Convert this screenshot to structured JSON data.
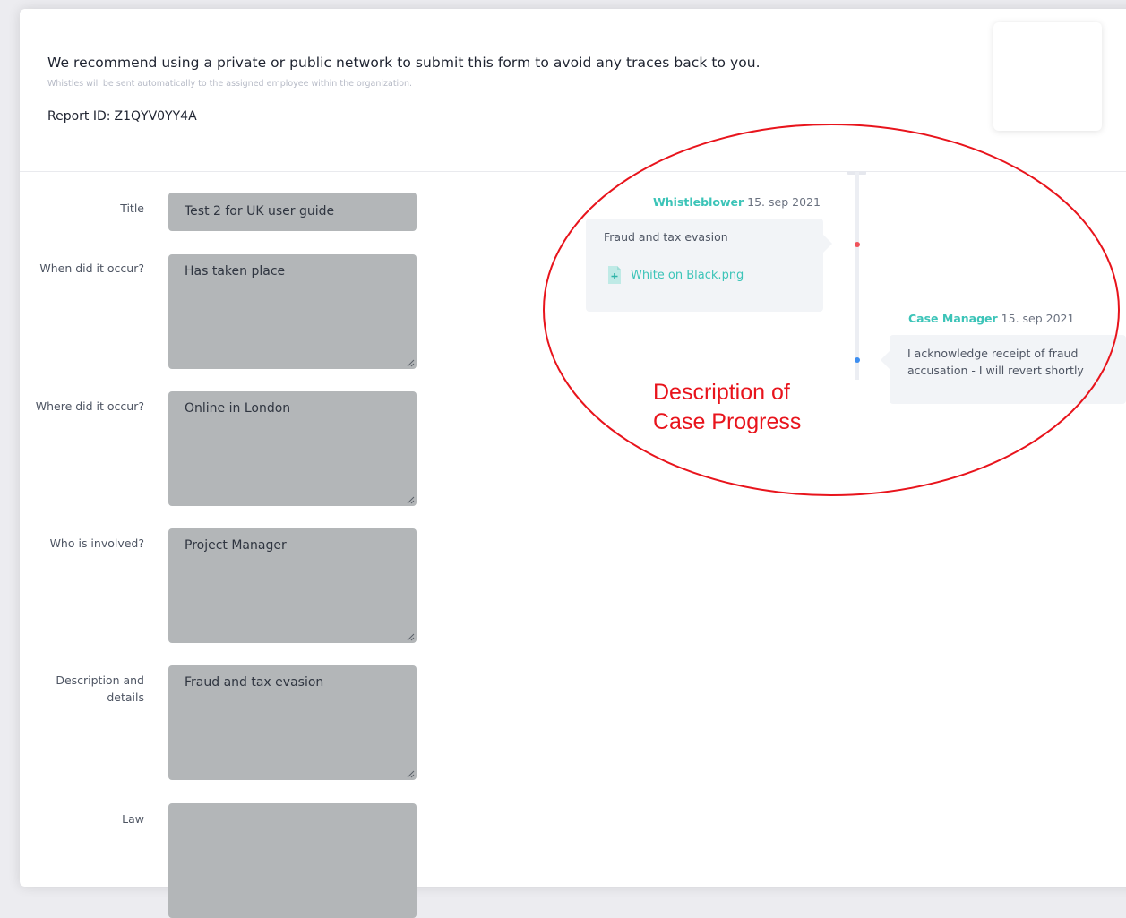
{
  "header": {
    "title": "We recommend using a private or public network to submit this form to avoid any traces back to you.",
    "subtitle": "Whistles will be sent automatically to the assigned employee within the organization.",
    "report_id_label": "Report ID:",
    "report_id_value": "Z1QYV0YY4A"
  },
  "form": {
    "fields": [
      {
        "label": "Title",
        "value": "Test 2 for UK user guide"
      },
      {
        "label": "When did it occur?",
        "value": "Has taken place"
      },
      {
        "label": "Where did it occur?",
        "value": "Online in London"
      },
      {
        "label": "Who is involved?",
        "value": "Project Manager"
      },
      {
        "label_line1": "Description and",
        "label_line2": "details",
        "value": "Fraud and tax evasion"
      },
      {
        "label": "Law",
        "value": ""
      }
    ]
  },
  "timeline": {
    "messages": [
      {
        "author": "Whistleblower",
        "date": "15. sep 2021",
        "text": "Fraud and tax evasion",
        "attachment": "White on Black.png",
        "dot_color": "#f0525a"
      },
      {
        "author": "Case Manager",
        "date": "15. sep 2021",
        "text_line1": "I acknowledge receipt of fraud",
        "text_line2": "accusation - I will revert shortly",
        "dot_color": "#3d8ef0"
      }
    ]
  },
  "annotation": {
    "line1": "Description of",
    "line2": "Case Progress",
    "color": "#e8141c"
  },
  "colors": {
    "accent": "#3cc4b8",
    "field_bg": "#b3b6b8"
  }
}
